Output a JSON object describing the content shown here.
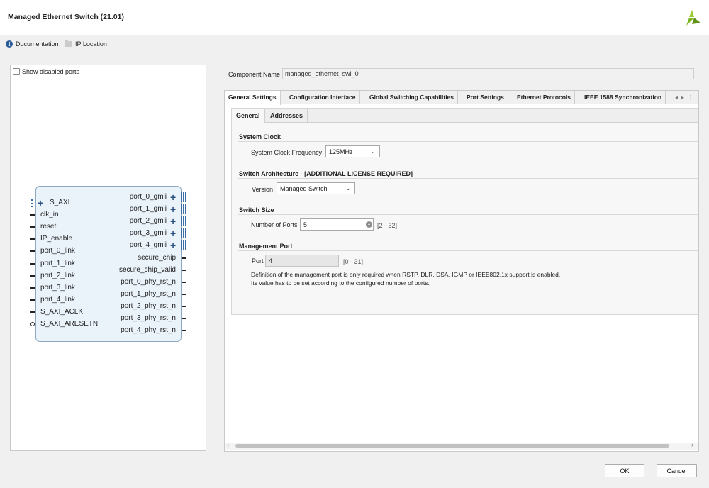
{
  "window": {
    "title": "Managed Ethernet Switch (21.01)"
  },
  "toolbar": {
    "documentation": "Documentation",
    "ip_location": "IP Location"
  },
  "left_panel": {
    "show_disabled_ports": "Show disabled ports",
    "block": {
      "left_pins": [
        "S_AXI",
        "clk_in",
        "reset",
        "IP_enable",
        "port_0_link",
        "port_1_link",
        "port_2_link",
        "port_3_link",
        "port_4_link",
        "S_AXI_ACLK",
        "S_AXI_ARESETN"
      ],
      "right_pins": [
        "port_0_gmii",
        "port_1_gmii",
        "port_2_gmii",
        "port_3_gmii",
        "port_4_gmii",
        "secure_chip",
        "secure_chip_valid",
        "port_0_phy_rst_n",
        "port_1_phy_rst_n",
        "port_2_phy_rst_n",
        "port_3_phy_rst_n",
        "port_4_phy_rst_n"
      ]
    }
  },
  "component": {
    "label": "Component Name",
    "value": "managed_ethernet_swi_0"
  },
  "tabs": [
    "General Settings",
    "Configuration Interface",
    "Global Switching Capabilities",
    "Port Settings",
    "Ethernet Protocols",
    "IEEE 1588 Synchronization"
  ],
  "subtabs": [
    "General",
    "Addresses"
  ],
  "general": {
    "system_clock": {
      "title": "System Clock",
      "freq_label": "System Clock Frequency",
      "freq_value": "125MHz"
    },
    "switch_arch": {
      "title": "Switch Architecture - [ADDITIONAL LICENSE REQUIRED]",
      "version_label": "Version",
      "version_value": "Managed Switch"
    },
    "switch_size": {
      "title": "Switch Size",
      "ports_label": "Number of Ports",
      "ports_value": "5",
      "ports_range": "[2 - 32]"
    },
    "mgmt_port": {
      "title": "Management Port",
      "port_label": "Port",
      "port_value": "4",
      "port_range": "[0 - 31]",
      "desc_1": "Definition of the management port is only required when RSTP, DLR, DSA, IGMP or IEEE802.1x support is enabled.",
      "desc_2": "Its value has to be set according to the configured number of ports."
    }
  },
  "buttons": {
    "ok": "OK",
    "cancel": "Cancel"
  },
  "colors": {
    "accent": "#2a5b98",
    "block_fill": "#eaf2fa",
    "logo_green": "#7ab51d"
  }
}
